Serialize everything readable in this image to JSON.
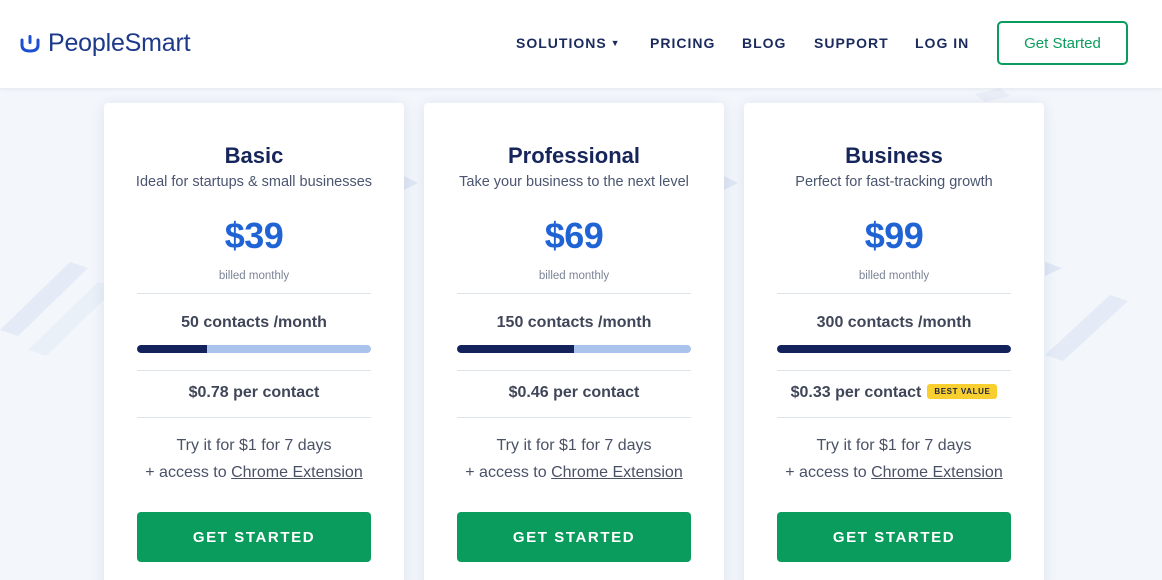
{
  "brand": {
    "name": "PeopleSmart",
    "color": "#1f4fd1"
  },
  "nav": {
    "items": [
      {
        "label": "SOLUTIONS",
        "has_caret": true
      },
      {
        "label": "PRICING"
      },
      {
        "label": "BLOG"
      },
      {
        "label": "SUPPORT"
      },
      {
        "label": "LOG IN"
      }
    ],
    "caret": "▼",
    "cta_label": "Get Started"
  },
  "colors": {
    "accent_green": "#0a9c5c",
    "price_blue": "#1f63d4",
    "bar_dark": "#14225b",
    "bar_light": "#a9c3ec",
    "badge_yellow": "#f9cf2f"
  },
  "plans": [
    {
      "name": "Basic",
      "description": "Ideal for startups & small businesses",
      "price": "$39",
      "billing": "billed monthly",
      "contacts": "50 contacts /month",
      "usage_fraction": 0.3,
      "per_contact": "$0.78 per contact",
      "badge": "",
      "trial": "Try it for $1 for 7 days",
      "access_prefix": "+ access to",
      "access_link": "Chrome Extension",
      "cta_label": "GET STARTED"
    },
    {
      "name": "Professional",
      "description": "Take your business to the next level",
      "price": "$69",
      "billing": "billed monthly",
      "contacts": "150 contacts /month",
      "usage_fraction": 0.5,
      "per_contact": "$0.46 per contact",
      "badge": "",
      "trial": "Try it for $1 for 7 days",
      "access_prefix": "+ access to",
      "access_link": "Chrome Extension",
      "cta_label": "GET STARTED"
    },
    {
      "name": "Business",
      "description": "Perfect for fast-tracking growth",
      "price": "$99",
      "billing": "billed monthly",
      "contacts": "300 contacts /month",
      "usage_fraction": 1.0,
      "per_contact": "$0.33 per contact",
      "badge": "BEST VALUE",
      "trial": "Try it for $1 for 7 days",
      "access_prefix": "+ access to",
      "access_link": "Chrome Extension",
      "cta_label": "GET STARTED"
    }
  ]
}
